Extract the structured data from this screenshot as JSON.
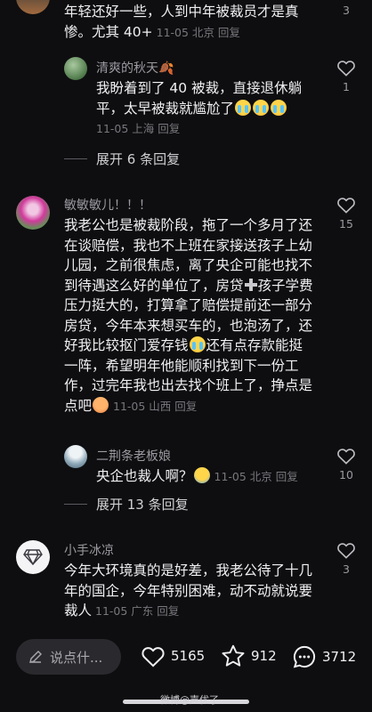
{
  "comments": [
    {
      "text": "年轻还好一些，人到中年被裁员才是真惨。尤其 40+",
      "meta": "11-05 北京 回复",
      "likes": "3"
    },
    {
      "name": "清爽的秋天🍂",
      "text_a": "我盼着到了 40 被裁，直接退休躺平，太早被裁就尴尬了",
      "meta": "11-05 上海 回复",
      "likes": "1",
      "expand": "展开 6 条回复"
    },
    {
      "name": "敏敏敏儿！！！",
      "text_a": "我老公也是被裁阶段，拖了一个多月了还在谈赔偿，我也不上班在家接送孩子上幼儿园，之前很焦虑，离了央企可能也找不到待遇这么好的单位了，房贷",
      "text_b": "孩子学费压力挺大的，打算拿了赔偿提前还一部分房贷，今年本来想买车的，也泡汤了，还好我比较抠门爱存钱",
      "text_c": "还有点存款能挺一阵，希望明年他能顺利找到下一份工作，过完年我也出去找个班上了，挣点是点吧",
      "meta": "11-05 山西 回复",
      "likes": "15"
    },
    {
      "name": "二荆条老板娘",
      "text_a": "央企也裁人啊？",
      "meta": "11-05 北京 回复",
      "likes": "10",
      "expand": "展开 13 条回复"
    },
    {
      "name": "小手冰凉",
      "text_a": "今年大环境真的是好差，我老公待了十几年的国企，今年特别困难，动不动就说要裁人",
      "meta": "11-05 广东 回复",
      "likes": "3"
    }
  ],
  "bottom_bar": {
    "input_placeholder": "说点什...",
    "likes": "5165",
    "favorites": "912",
    "comments": "3712"
  },
  "watermark": "微博@声优了",
  "icons": {
    "like": "heart-outline-icon",
    "edit": "pencil-icon",
    "favorite": "star-outline-icon",
    "comment": "speech-bubble-icon"
  }
}
